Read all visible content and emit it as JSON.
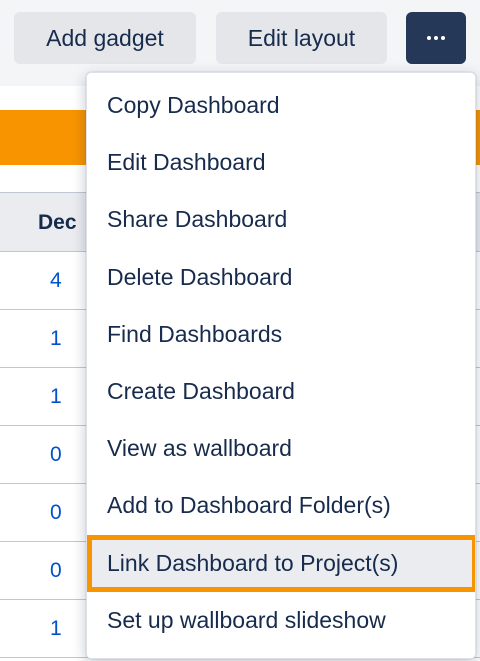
{
  "toolbar": {
    "add_gadget_label": "Add gadget",
    "edit_layout_label": "Edit layout",
    "more_icon": "ellipsis-icon"
  },
  "table": {
    "header_label": "Dec",
    "rows": [
      "4",
      "1",
      "1",
      "0",
      "0",
      "0",
      "1"
    ]
  },
  "menu": {
    "items": [
      "Copy Dashboard",
      "Edit Dashboard",
      "Share Dashboard",
      "Delete Dashboard",
      "Find Dashboards",
      "Create Dashboard",
      "View as wallboard",
      "Add to Dashboard Folder(s)",
      "Link Dashboard to Project(s)",
      "Set up wallboard slideshow"
    ],
    "highlighted_item": "Link Dashboard to Project(s)"
  },
  "colors": {
    "accent_orange": "#f79400",
    "more_button_bg": "#253858",
    "link_blue": "#0052cc",
    "text": "#172b4d"
  }
}
